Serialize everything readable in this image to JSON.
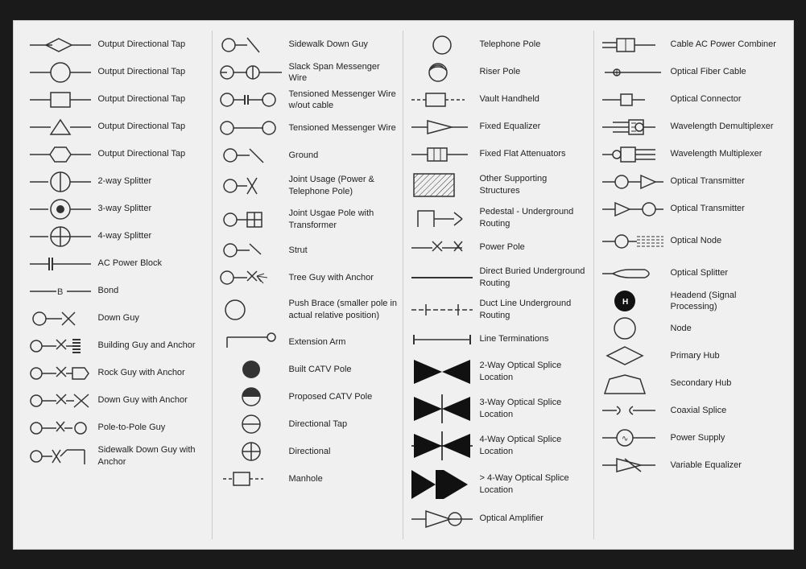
{
  "columns": [
    {
      "items": [
        {
          "id": "out-dir-tap-1",
          "label": "Output Directional Tap",
          "symbol": "diamond-line"
        },
        {
          "id": "out-dir-tap-2",
          "label": "Output Directional Tap",
          "symbol": "circle-line"
        },
        {
          "id": "out-dir-tap-3",
          "label": "Output Directional Tap",
          "symbol": "square-line"
        },
        {
          "id": "out-dir-tap-4",
          "label": "Output Directional Tap",
          "symbol": "triangle-line"
        },
        {
          "id": "out-dir-tap-5",
          "label": "Output Directional Tap",
          "symbol": "hexagon-line"
        },
        {
          "id": "2way-splitter",
          "label": "2-way Splitter",
          "symbol": "2way-splitter"
        },
        {
          "id": "3way-splitter",
          "label": "3-way Splitter",
          "symbol": "3way-splitter"
        },
        {
          "id": "4way-splitter",
          "label": "4-way Splitter",
          "symbol": "4way-splitter"
        },
        {
          "id": "ac-power-block",
          "label": "AC Power Block",
          "symbol": "ac-power-block"
        },
        {
          "id": "bond",
          "label": "Bond",
          "symbol": "bond"
        },
        {
          "id": "down-guy",
          "label": "Down Guy",
          "symbol": "down-guy"
        },
        {
          "id": "building-guy-anchor",
          "label": "Building Guy and Anchor",
          "symbol": "building-guy-anchor"
        },
        {
          "id": "rock-guy-anchor",
          "label": "Rock Guy with Anchor",
          "symbol": "rock-guy-anchor"
        },
        {
          "id": "down-guy-anchor",
          "label": "Down Guy with Anchor",
          "symbol": "down-guy-anchor"
        },
        {
          "id": "pole-to-pole-guy",
          "label": "Pole-to-Pole Guy",
          "symbol": "pole-to-pole-guy"
        },
        {
          "id": "sidewalk-down-guy-anchor",
          "label": "Sidewalk Down Guy with Anchor",
          "symbol": "sidewalk-down-guy-anchor"
        }
      ]
    },
    {
      "items": [
        {
          "id": "sidewalk-down-guy",
          "label": "Sidewalk Down Guy",
          "symbol": "sidewalk-down-guy"
        },
        {
          "id": "slack-span",
          "label": "Slack Span Messenger Wire",
          "symbol": "slack-span"
        },
        {
          "id": "tensioned-wire-no-cable",
          "label": "Tensioned Messenger Wire w/out cable",
          "symbol": "tensioned-wire-no-cable"
        },
        {
          "id": "tensioned-wire",
          "label": "Tensioned Messenger Wire",
          "symbol": "tensioned-wire"
        },
        {
          "id": "ground",
          "label": "Ground",
          "symbol": "ground"
        },
        {
          "id": "joint-usage",
          "label": "Joint Usage (Power & Telephone Pole)",
          "symbol": "joint-usage"
        },
        {
          "id": "joint-usgae-transformer",
          "label": "Joint Usgae Pole with Transformer",
          "symbol": "joint-transformer"
        },
        {
          "id": "strut",
          "label": "Strut",
          "symbol": "strut"
        },
        {
          "id": "tree-guy-anchor",
          "label": "Tree Guy with Anchor",
          "symbol": "tree-guy-anchor"
        },
        {
          "id": "push-brace",
          "label": "Push Brace (smaller pole in actual relative position)",
          "symbol": "push-brace"
        },
        {
          "id": "extension-arm",
          "label": "Extension Arm",
          "symbol": "extension-arm"
        },
        {
          "id": "built-catv-pole",
          "label": "Built CATV Pole",
          "symbol": "built-catv-pole"
        },
        {
          "id": "proposed-catv-pole",
          "label": "Proposed CATV Pole",
          "symbol": "proposed-catv-pole"
        },
        {
          "id": "directional-tap-1",
          "label": "Directional Tap",
          "symbol": "directional-tap-1"
        },
        {
          "id": "directional-tap-2",
          "label": "Directional",
          "symbol": "directional-tap-2"
        },
        {
          "id": "manhole",
          "label": "Manhole",
          "symbol": "manhole"
        }
      ]
    },
    {
      "items": [
        {
          "id": "telephone-pole",
          "label": "Telephone Pole",
          "symbol": "telephone-pole"
        },
        {
          "id": "riser-pole",
          "label": "Riser Pole",
          "symbol": "riser-pole"
        },
        {
          "id": "vault-handheld",
          "label": "Vault Handheld",
          "symbol": "vault-handheld"
        },
        {
          "id": "fixed-equalizer",
          "label": "Fixed Equalizer",
          "symbol": "fixed-equalizer"
        },
        {
          "id": "fixed-flat-attenuators",
          "label": "Fixed Flat Attenuators",
          "symbol": "fixed-flat-attenuators"
        },
        {
          "id": "other-supporting",
          "label": "Other Supporting Structures",
          "symbol": "other-supporting"
        },
        {
          "id": "pedestal-underground",
          "label": "Pedestal - Underground Routing",
          "symbol": "pedestal-underground"
        },
        {
          "id": "power-pole",
          "label": "Power Pole",
          "symbol": "power-pole"
        },
        {
          "id": "direct-buried",
          "label": "Direct Buried Underground Routing",
          "symbol": "direct-buried"
        },
        {
          "id": "duct-line",
          "label": "Duct Line Underground Routing",
          "symbol": "duct-line"
        },
        {
          "id": "line-terminations",
          "label": "Line Terminations",
          "symbol": "line-terminations"
        },
        {
          "id": "2way-optical-splice",
          "label": "2-Way Optical Splice Location",
          "symbol": "2way-optical-splice"
        },
        {
          "id": "3way-optical-splice",
          "label": "3-Way Optical Splice Location",
          "symbol": "3way-optical-splice"
        },
        {
          "id": "4way-optical-splice",
          "label": "4-Way Optical Splice Location",
          "symbol": "4way-optical-splice"
        },
        {
          "id": "4plus-optical-splice",
          "label": "> 4-Way Optical Splice Location",
          "symbol": "4plus-optical-splice"
        },
        {
          "id": "optical-amplifier",
          "label": "Optical Amplifier",
          "symbol": "optical-amplifier"
        }
      ]
    },
    {
      "items": [
        {
          "id": "cable-ac-power-combiner",
          "label": "Cable AC Power Combiner",
          "symbol": "cable-ac-power-combiner"
        },
        {
          "id": "optical-fiber-cable",
          "label": "Optical Fiber Cable",
          "symbol": "optical-fiber-cable"
        },
        {
          "id": "optical-connector",
          "label": "Optical Connector",
          "symbol": "optical-connector"
        },
        {
          "id": "wavelength-demux",
          "label": "Wavelength Demultiplexer",
          "symbol": "wavelength-demux"
        },
        {
          "id": "wavelength-mux",
          "label": "Wavelength Multiplexer",
          "symbol": "wavelength-mux"
        },
        {
          "id": "optical-transmitter-1",
          "label": "Optical Transmitter",
          "symbol": "optical-transmitter-1"
        },
        {
          "id": "optical-transmitter-2",
          "label": "Optical Transmitter",
          "symbol": "optical-transmitter-2"
        },
        {
          "id": "optical-node",
          "label": "Optical Node",
          "symbol": "optical-node"
        },
        {
          "id": "optical-splitter",
          "label": "Optical Splitter",
          "symbol": "optical-splitter"
        },
        {
          "id": "headend",
          "label": "Headend (Signal Processing)",
          "symbol": "headend"
        },
        {
          "id": "node",
          "label": "Node",
          "symbol": "node"
        },
        {
          "id": "primary-hub",
          "label": "Primary Hub",
          "symbol": "primary-hub"
        },
        {
          "id": "secondary-hub",
          "label": "Secondary Hub",
          "symbol": "secondary-hub"
        },
        {
          "id": "coaxial-splice",
          "label": "Coaxial Splice",
          "symbol": "coaxial-splice"
        },
        {
          "id": "power-supply",
          "label": "Power Supply",
          "symbol": "power-supply"
        },
        {
          "id": "variable-equalizer",
          "label": "Variable Equalizer",
          "symbol": "variable-equalizer"
        }
      ]
    }
  ]
}
